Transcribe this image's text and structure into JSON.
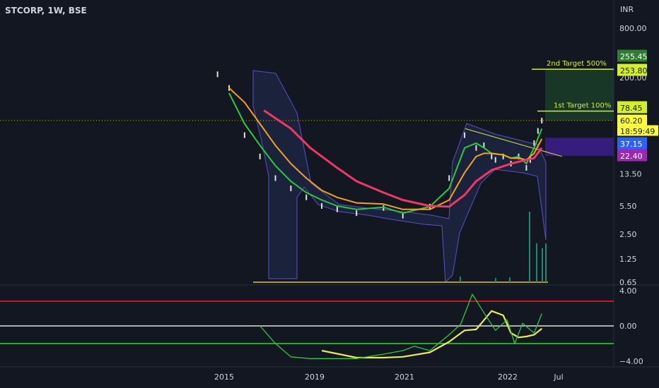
{
  "header": {
    "symbol": "STCORP, 1W, BSE",
    "currency": "INR"
  },
  "chart_data": [
    {
      "type": "line",
      "title": "STCORP, 1W, BSE",
      "scale": "log",
      "ylim": [
        0.65,
        800
      ],
      "yticks": [
        {
          "value": 800,
          "label": "800.00"
        },
        {
          "value": 200,
          "label": "200.00"
        },
        {
          "value": 13.5,
          "label": "13.50"
        },
        {
          "value": 5.5,
          "label": "5.50"
        },
        {
          "value": 2.5,
          "label": "2.50"
        },
        {
          "value": 1.25,
          "label": "1.25"
        },
        {
          "value": 0.65,
          "label": "0.65"
        }
      ],
      "xticks": [
        "2015",
        "2019",
        "2021",
        "2022",
        "Jul"
      ],
      "series": [
        {
          "name": "",
          "type": "candlestick-close",
          "color": "#e0e0e0",
          "x": [
            "2015-06",
            "2015-09",
            "2016-01",
            "2016-05",
            "2016-09",
            "2017-01",
            "2017-05",
            "2017-09",
            "2018-01",
            "2018-06",
            "2019-01",
            "2019-06",
            "2020-01",
            "2020-06",
            "2020-10",
            "2021-01",
            "2021-03",
            "2021-05",
            "2021-06",
            "2021-08",
            "2021-10",
            "2021-12",
            "2022-02",
            "2022-03",
            "2022-04",
            "2022-05",
            "2022-06"
          ],
          "y": [
            220,
            150,
            40,
            22,
            12,
            9,
            7,
            5.5,
            5,
            4.5,
            5.2,
            4.2,
            5.4,
            12,
            40,
            28,
            30,
            22,
            20,
            22,
            18,
            22,
            16,
            20,
            32,
            45,
            60.2
          ]
        },
        {
          "name": "",
          "color": "#2bc93e",
          "x": [
            "2015-09",
            "2016-01",
            "2016-05",
            "2016-09",
            "2017-01",
            "2017-05",
            "2017-09",
            "2018-01",
            "2018-06",
            "2019-01",
            "2019-06",
            "2020-01",
            "2020-06",
            "2020-10",
            "2021-01",
            "2021-03",
            "2021-05",
            "2021-08",
            "2021-10",
            "2021-12",
            "2022-02",
            "2022-04",
            "2022-06"
          ],
          "y": [
            130,
            55,
            30,
            17,
            11,
            8,
            6.5,
            5.5,
            5,
            5.3,
            4.5,
            5.4,
            9,
            28,
            32,
            28,
            24,
            23,
            21,
            22,
            18,
            28,
            48
          ]
        },
        {
          "name": "",
          "color": "#f7a21b",
          "x": [
            "2015-09",
            "2016-01",
            "2016-05",
            "2016-09",
            "2017-01",
            "2017-05",
            "2017-09",
            "2018-01",
            "2018-06",
            "2019-01",
            "2019-06",
            "2020-01",
            "2020-06",
            "2020-10",
            "2021-01",
            "2021-03",
            "2021-05",
            "2021-08",
            "2021-10",
            "2021-12",
            "2022-02",
            "2022-04",
            "2022-06"
          ],
          "y": [
            150,
            100,
            55,
            30,
            18,
            12,
            8.5,
            7,
            6,
            5.8,
            5,
            5,
            6.5,
            14,
            22,
            24,
            24,
            23,
            21,
            21,
            20,
            24,
            36
          ]
        },
        {
          "name": "",
          "color": "#f23862",
          "x": [
            "2016-06",
            "2017-01",
            "2017-06",
            "2018-01",
            "2018-06",
            "2019-01",
            "2019-06",
            "2020-01",
            "2020-06",
            "2020-10",
            "2021-01",
            "2021-05",
            "2021-10",
            "2022-02",
            "2022-04",
            "2022-06"
          ],
          "y": [
            80,
            48,
            28,
            16,
            11,
            8,
            6.5,
            5.5,
            5.4,
            7.5,
            11,
            15,
            18,
            20,
            21,
            28
          ]
        }
      ],
      "annotations": [
        {
          "text": "2nd Target 500%",
          "value": 253.8
        },
        {
          "text": "1st Target 100%",
          "value": 78.45
        }
      ],
      "price_labels": [
        {
          "text": "255.45",
          "bg": "#2e7d32",
          "fg": "#ffffff"
        },
        {
          "text": "253.80",
          "bg": "#d4f020",
          "fg": "#131722"
        },
        {
          "text": "78.45",
          "bg": "#d4f020",
          "fg": "#131722"
        },
        {
          "text": "60.20",
          "bg": "#ffff33",
          "fg": "#131722"
        },
        {
          "text": "18:59:49",
          "bg": "#ffff33",
          "fg": "#131722"
        },
        {
          "text": "37.15",
          "bg": "#2962ff",
          "fg": "#ffffff"
        },
        {
          "text": "22.40",
          "bg": "#9c27b0",
          "fg": "#ffffff"
        }
      ]
    },
    {
      "type": "line",
      "ylim": [
        -4,
        4
      ],
      "yticks": [
        {
          "value": 4,
          "label": "4.00"
        },
        {
          "value": 0,
          "label": "0.00"
        },
        {
          "value": -4,
          "label": "−4.00"
        }
      ],
      "levels": [
        {
          "value": 2.8,
          "color": "#ff1a1a"
        },
        {
          "value": 0,
          "color": "#e0e0e0"
        },
        {
          "value": -2,
          "color": "#22e022"
        }
      ],
      "series": [
        {
          "name": "",
          "color": "#e8eb52",
          "x": [
            "2017-09",
            "2018-06",
            "2019-01",
            "2019-06",
            "2020-01",
            "2020-06",
            "2020-10",
            "2021-01",
            "2021-05",
            "2021-08",
            "2021-10",
            "2021-12",
            "2022-02",
            "2022-04",
            "2022-06"
          ],
          "y": [
            -2.8,
            -3.6,
            -3.6,
            -3.5,
            -3,
            -1.8,
            -0.5,
            -0.4,
            1.7,
            1.2,
            -0.8,
            -1.3,
            -1.2,
            -1,
            -0.3
          ]
        },
        {
          "name": "",
          "color": "#2bc93e",
          "x": [
            "2016-05",
            "2016-09",
            "2017-01",
            "2017-06",
            "2018-06",
            "2019-01",
            "2019-06",
            "2019-09",
            "2020-01",
            "2020-06",
            "2020-09",
            "2020-12",
            "2021-03",
            "2021-06",
            "2021-09",
            "2021-11",
            "2022-01",
            "2022-04",
            "2022-06"
          ],
          "y": [
            0,
            -2,
            -3.5,
            -3.7,
            -3.7,
            -3.2,
            -2.8,
            -2.3,
            -2.8,
            -1,
            0.2,
            3.6,
            1.5,
            -0.5,
            0.7,
            -2,
            0.3,
            -0.8,
            1.4
          ]
        }
      ]
    }
  ]
}
